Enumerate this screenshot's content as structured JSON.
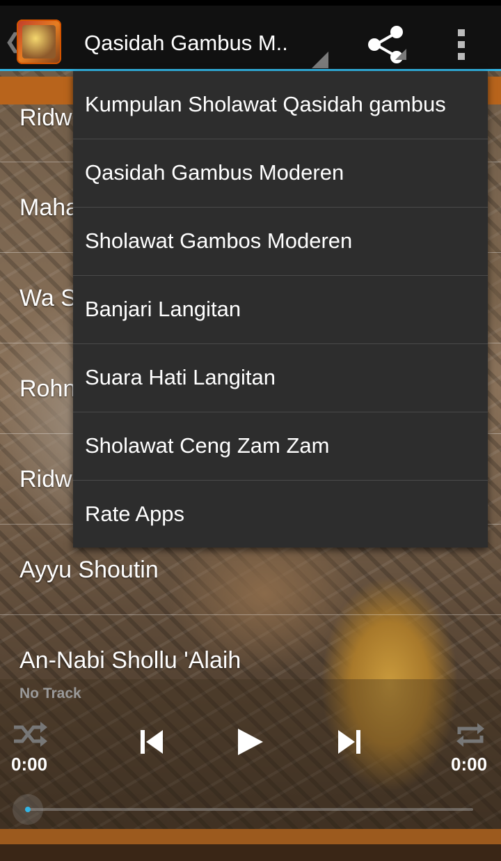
{
  "actionbar": {
    "title": "Qasidah Gambus M..",
    "app_icon": "app-logo",
    "share_icon": "share-icon",
    "overflow_icon": "more-vert-icon"
  },
  "list": {
    "items": [
      {
        "label": "Ridw"
      },
      {
        "label": "Maha"
      },
      {
        "label": "Wa S"
      },
      {
        "label": "Rohn"
      },
      {
        "label": "Ridw"
      },
      {
        "label": "Ayyu Shoutin"
      },
      {
        "label": "An-Nabi Shollu 'Alaih"
      }
    ]
  },
  "player": {
    "track": "No Track",
    "time_elapsed": "0:00",
    "time_total": "0:00",
    "progress": 0,
    "icons": [
      "shuffle-icon",
      "previous-icon",
      "play-icon",
      "next-icon",
      "repeat-icon"
    ]
  },
  "menu": {
    "items": [
      {
        "label": "Kumpulan Sholawat Qasidah gambus"
      },
      {
        "label": "Qasidah Gambus Moderen"
      },
      {
        "label": "Sholawat Gambos Moderen"
      },
      {
        "label": "Banjari Langitan"
      },
      {
        "label": "Suara Hati Langitan"
      },
      {
        "label": "Sholawat Ceng Zam Zam"
      },
      {
        "label": "Rate Apps"
      }
    ]
  },
  "colors": {
    "accent": "#33b5e5",
    "actionbar": "#111111",
    "menu_bg": "#2d2d2d",
    "orange": "#b8641c"
  }
}
